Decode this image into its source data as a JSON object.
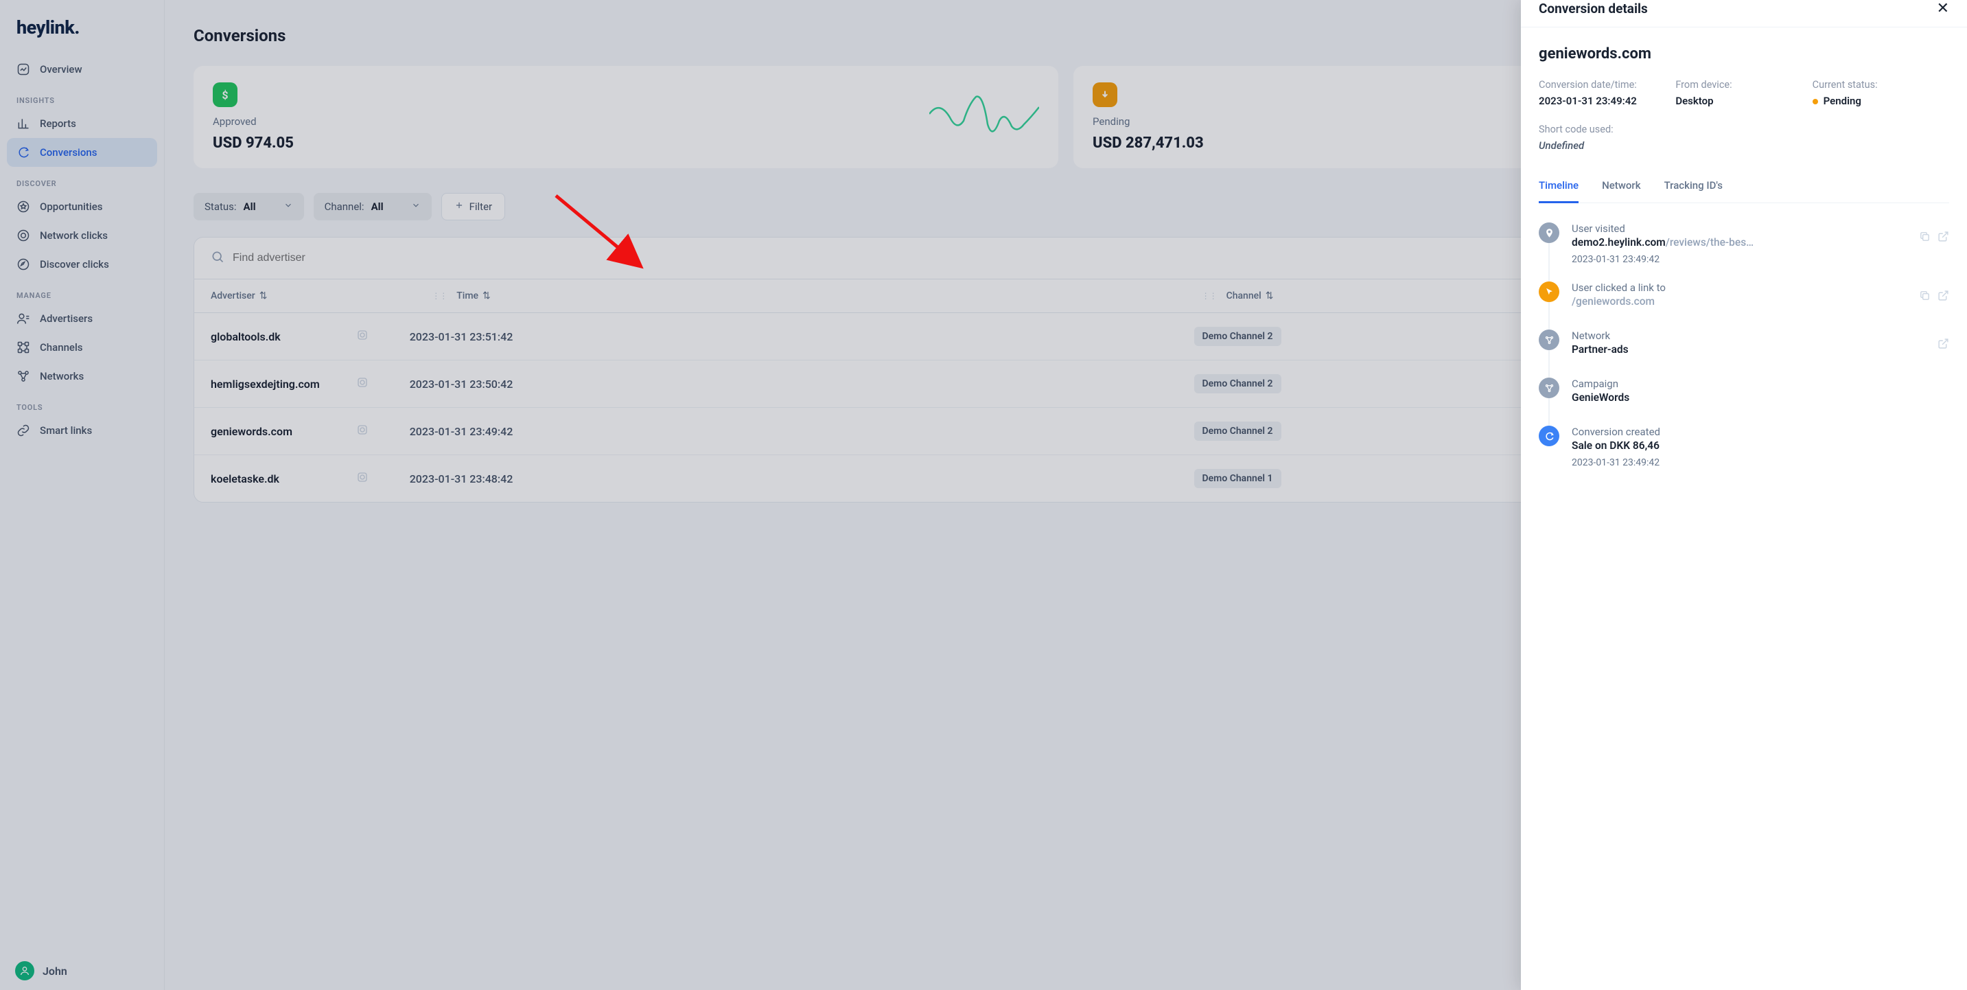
{
  "logo": "heylink",
  "sidebar": {
    "overview": "Overview",
    "sections": [
      {
        "title": "INSIGHTS",
        "items": [
          "Reports",
          "Conversions"
        ]
      },
      {
        "title": "DISCOVER",
        "items": [
          "Opportunities",
          "Network clicks",
          "Discover clicks"
        ]
      },
      {
        "title": "MANAGE",
        "items": [
          "Advertisers",
          "Channels",
          "Networks"
        ]
      },
      {
        "title": "TOOLS",
        "items": [
          "Smart links"
        ]
      }
    ],
    "user": "John"
  },
  "page": {
    "title": "Conversions"
  },
  "stats": {
    "approved": {
      "label": "Approved",
      "value": "USD 974.05"
    },
    "pending": {
      "label": "Pending",
      "value": "USD 287,471.03"
    }
  },
  "filters": {
    "status_label": "Status:",
    "status_value": "All",
    "channel_label": "Channel:",
    "channel_value": "All",
    "filter_btn": "Filter"
  },
  "table": {
    "search_placeholder": "Find advertiser",
    "headers": {
      "advertiser": "Advertiser",
      "time": "Time",
      "channel": "Channel"
    },
    "rows": [
      {
        "advertiser": "globaltools.dk",
        "time": "2023-01-31 23:51:42",
        "channel": "Demo Channel 2"
      },
      {
        "advertiser": "hemligsexdejting.com",
        "time": "2023-01-31 23:50:42",
        "channel": "Demo Channel 2"
      },
      {
        "advertiser": "geniewords.com",
        "time": "2023-01-31 23:49:42",
        "channel": "Demo Channel 2"
      },
      {
        "advertiser": "koeletaske.dk",
        "time": "2023-01-31 23:48:42",
        "channel": "Demo Channel 1"
      }
    ]
  },
  "drawer": {
    "title": "Conversion details",
    "advertiser": "geniewords.com",
    "meta": {
      "date_label": "Conversion date/time:",
      "date_value": "2023-01-31 23:49:42",
      "device_label": "From device:",
      "device_value": "Desktop",
      "status_label": "Current status:",
      "status_value": "Pending",
      "shortcode_label": "Short code used:",
      "shortcode_value": "Undefined"
    },
    "tabs": [
      "Timeline",
      "Network",
      "Tracking ID's"
    ],
    "timeline": [
      {
        "icon": "pin",
        "color": "gray",
        "title": "User visited",
        "sub_main": "demo2.heylink.com",
        "sub_dim": "/reviews/the-bes…",
        "time": "2023-01-31 23:49:42",
        "actions": true
      },
      {
        "icon": "click",
        "color": "yellow",
        "title": "User clicked a link to",
        "sub_main": "",
        "sub_dim": "/geniewords.com",
        "time": "",
        "actions": true
      },
      {
        "icon": "net",
        "color": "gray",
        "title": "Network",
        "sub_main": "Partner-ads",
        "sub_dim": "",
        "time": "",
        "actions": "open"
      },
      {
        "icon": "camp",
        "color": "gray",
        "title": "Campaign",
        "sub_main": "GenieWords",
        "sub_dim": "",
        "time": "",
        "actions": false
      },
      {
        "icon": "conv",
        "color": "blue",
        "title": "Conversion created",
        "sub_main": "Sale on DKK 86,46",
        "sub_dim": "",
        "time": "2023-01-31 23:49:42",
        "actions": false
      }
    ]
  }
}
